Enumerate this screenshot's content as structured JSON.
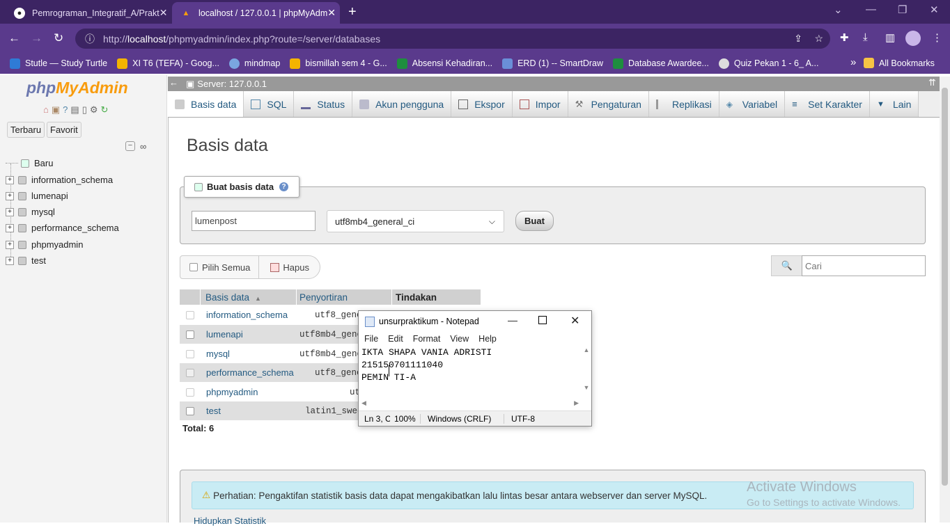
{
  "browser": {
    "tabs": [
      {
        "title": "Pemrograman_Integratif_A/Prakt",
        "active": false
      },
      {
        "title": "localhost / 127.0.0.1 | phpMyAdm",
        "active": true
      }
    ],
    "url_prefix": "http://",
    "url_host": "localhost",
    "url_path": "/phpmyadmin/index.php?route=/server/databases",
    "bookmarks": [
      {
        "label": "Stutle — Study Turtle",
        "color": "#2f7bd6"
      },
      {
        "label": "XI T6 (TEFA) - Goog...",
        "color": "#f4b400"
      },
      {
        "label": "mindmap",
        "color": "#7aa6e0"
      },
      {
        "label": "bismillah sem 4 - G...",
        "color": "#f4b400"
      },
      {
        "label": "Absensi Kehadiran...",
        "color": "#1e8e3e"
      },
      {
        "label": "ERD (1) -- SmartDraw",
        "color": "#6a8fd8"
      },
      {
        "label": "Database Awardee...",
        "color": "#1e8e3e"
      },
      {
        "label": "Quiz Pekan 1 - 6_ A...",
        "color": "#dddddd"
      }
    ],
    "all_bookmarks": "All Bookmarks",
    "more_bookmarks": "»"
  },
  "nav": {
    "logo_php": "php",
    "logo_myadmin": "MyAdmin",
    "recent_btn": "Terbaru",
    "fav_btn": "Favorit",
    "tree": [
      "Baru",
      "information_schema",
      "lumenapi",
      "mysql",
      "performance_schema",
      "phpmyadmin",
      "test"
    ]
  },
  "main": {
    "server_label": "Server: 127.0.0.1",
    "tabs": [
      "Basis data",
      "SQL",
      "Status",
      "Akun pengguna",
      "Ekspor",
      "Impor",
      "Pengaturan",
      "Replikasi",
      "Variabel",
      "Set Karakter",
      "Lain"
    ],
    "heading": "Basis data",
    "create_legend": "Buat basis data",
    "db_name_value": "lumenpost",
    "collation_value": "utf8mb4_general_ci",
    "create_btn": "Buat",
    "select_all": "Pilih Semua",
    "delete_btn": "Hapus",
    "search_placeholder": "Cari",
    "columns": [
      "Basis data",
      "Penyortiran",
      "Tindakan"
    ],
    "rows": [
      {
        "name": "information_schema",
        "collation": "utf8_gener"
      },
      {
        "name": "lumenapi",
        "collation": "utf8mb4_gene"
      },
      {
        "name": "mysql",
        "collation": "utf8mb4_gene"
      },
      {
        "name": "performance_schema",
        "collation": "utf8_gene"
      },
      {
        "name": "phpmyadmin",
        "collation": "ut"
      },
      {
        "name": "test",
        "collation": "latin1_swed"
      }
    ],
    "total": "Total: 6",
    "notice": "Perhatian: Pengaktifan statistik basis data dapat mengakibatkan lalu lintas besar antara webserver dan server MySQL.",
    "stats_link": "Hidupkan Statistik"
  },
  "notepad": {
    "title": "unsurpraktikum - Notepad",
    "menu": [
      "File",
      "Edit",
      "Format",
      "View",
      "Help"
    ],
    "lines": [
      "IKTA SHAPA VANIA ADRISTI",
      "215150701111040",
      "PEMIN TI-A"
    ],
    "status_pos": "Ln 3, C",
    "status_zoom": "100%",
    "status_eol": "Windows (CRLF)",
    "status_enc": "UTF-8"
  },
  "watermark": {
    "line1": "Activate Windows",
    "line2": "Go to Settings to activate Windows."
  }
}
